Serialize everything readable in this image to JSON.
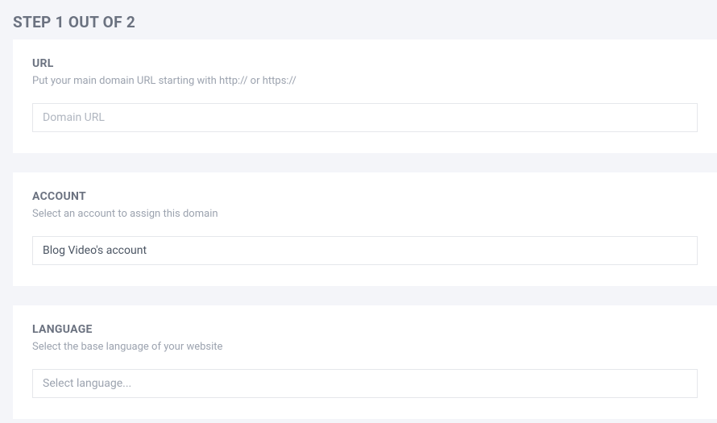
{
  "step_title": "STEP 1 OUT OF 2",
  "sections": {
    "url": {
      "title": "URL",
      "subtitle": "Put your main domain URL starting with http:// or https://",
      "placeholder": "Domain URL",
      "value": ""
    },
    "account": {
      "title": "ACCOUNT",
      "subtitle": "Select an account to assign this domain",
      "selected": "Blog Video's account"
    },
    "language": {
      "title": "LANGUAGE",
      "subtitle": "Select the base language of your website",
      "placeholder": "Select language..."
    }
  }
}
